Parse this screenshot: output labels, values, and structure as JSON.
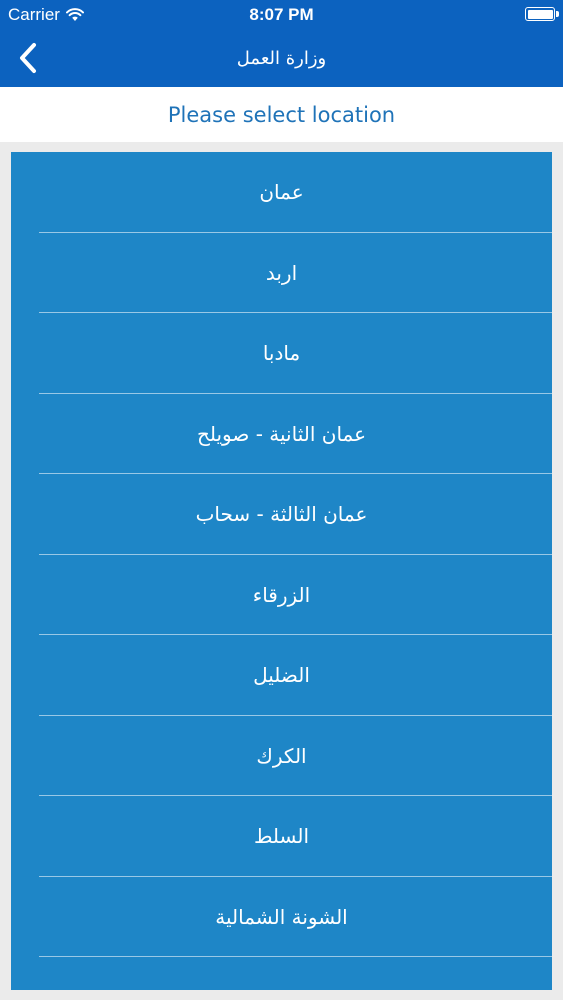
{
  "status_bar": {
    "carrier": "Carrier",
    "time": "8:07 PM"
  },
  "nav": {
    "title": "وزارة العمل",
    "back_icon": "chevron-left-icon"
  },
  "prompt": "Please select location",
  "locations": [
    {
      "label": "عمان"
    },
    {
      "label": "اربد"
    },
    {
      "label": "مادبا"
    },
    {
      "label": "عمان الثانية - صويلح"
    },
    {
      "label": "عمان الثالثة - سحاب"
    },
    {
      "label": "الزرقاء"
    },
    {
      "label": "الضليل"
    },
    {
      "label": "الكرك"
    },
    {
      "label": "السلط"
    },
    {
      "label": "الشونة الشمالية"
    }
  ],
  "colors": {
    "header_bg": "#0c62bf",
    "list_bg": "#1e86c7",
    "prompt_text": "#1f73b8",
    "page_bg": "#ebebeb"
  }
}
